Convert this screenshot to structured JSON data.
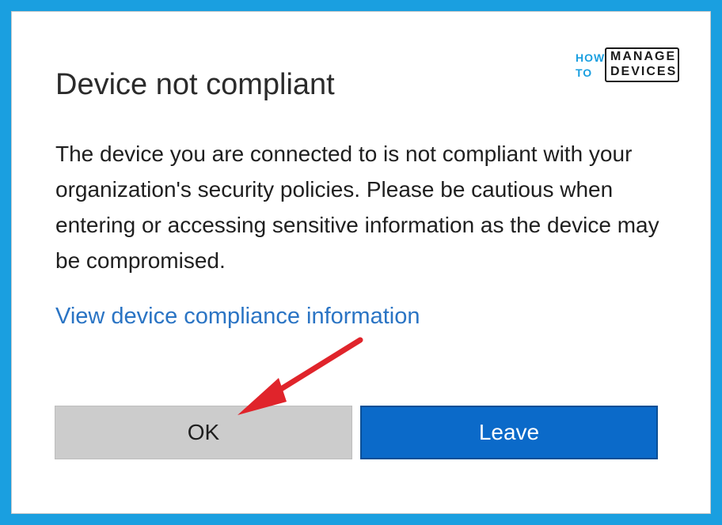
{
  "dialog": {
    "title": "Device not compliant",
    "message": "The device you are connected to is not compliant with your organization's security policies. Please be cautious when entering or accessing sensitive information as the device may be compromised.",
    "link_label": "View device compliance information",
    "ok_label": "OK",
    "leave_label": "Leave"
  },
  "logo": {
    "how": "HOW",
    "to": "TO",
    "manage": "MANAGE",
    "devices": "DEVICES"
  },
  "annotation": {
    "arrow_color": "#e0242b",
    "icon": "red-arrow-pointing-to-ok"
  },
  "colors": {
    "frame": "#1a9fe0",
    "link": "#2a74c4",
    "leave_button": "#0b6ac9",
    "ok_button": "#cccccc"
  }
}
